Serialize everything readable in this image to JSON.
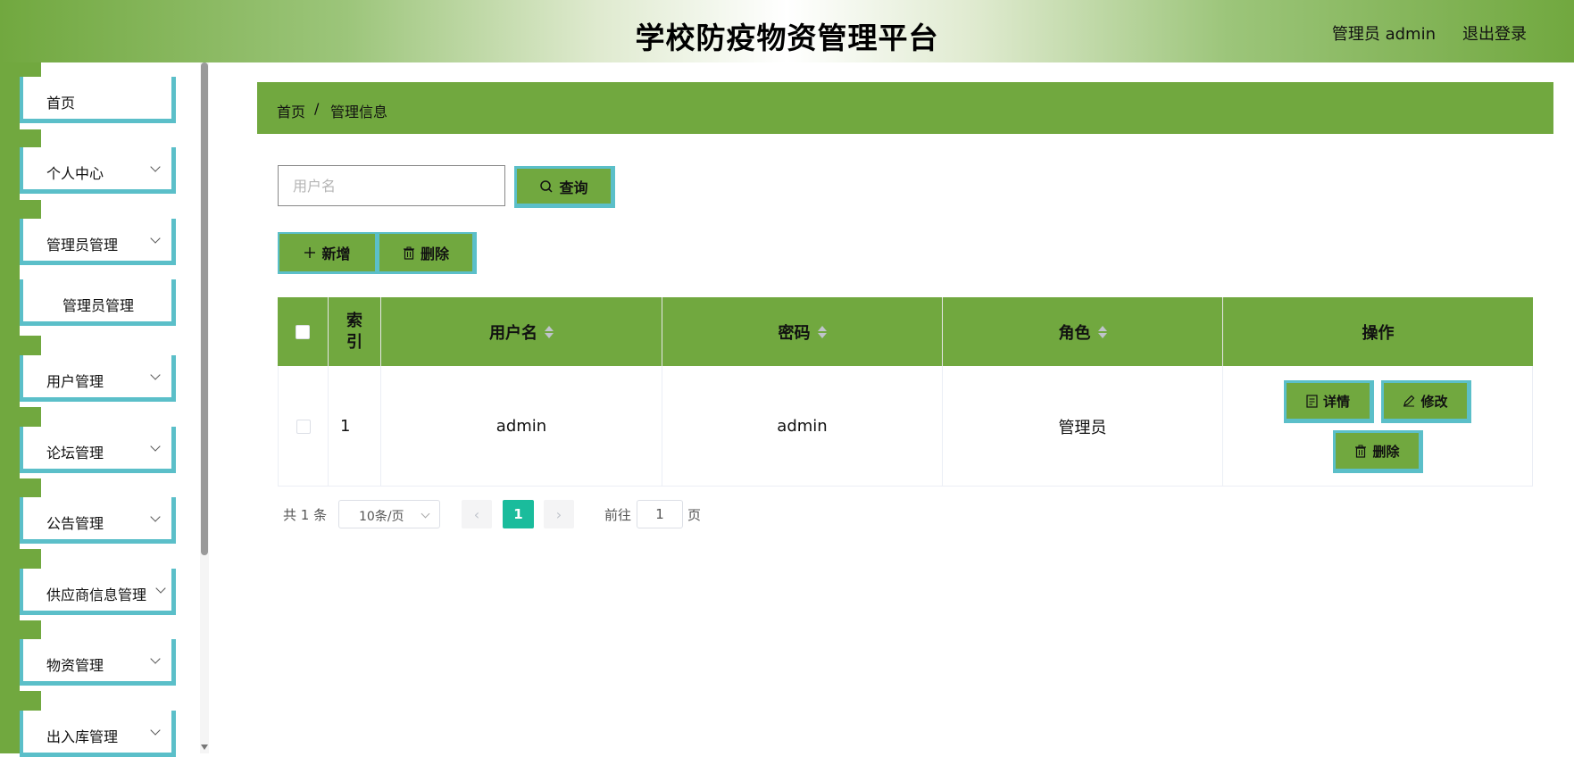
{
  "header": {
    "title": "学校防疫物资管理平台",
    "user": "管理员 admin",
    "logout": "退出登录"
  },
  "sidebar": {
    "items": [
      {
        "label": "首页"
      },
      {
        "label": "个人中心"
      },
      {
        "label": "管理员管理"
      },
      {
        "label": "管理员管理"
      },
      {
        "label": "用户管理"
      },
      {
        "label": "论坛管理"
      },
      {
        "label": "公告管理"
      },
      {
        "label": "供应商信息管理"
      },
      {
        "label": "物资管理"
      },
      {
        "label": "出入库管理"
      }
    ]
  },
  "breadcrumb": {
    "home": "首页",
    "separator": "/",
    "current": "管理信息"
  },
  "search": {
    "placeholder": "用户名",
    "button": "查询"
  },
  "actions": {
    "add": "新增",
    "delete": "删除"
  },
  "table": {
    "columns": [
      "索引",
      "用户名",
      "密码",
      "角色",
      "操作"
    ],
    "rows": [
      {
        "index": "1",
        "username": "admin",
        "password": "admin",
        "role": "管理员",
        "ops": {
          "detail": "详情",
          "edit": "修改",
          "delete": "删除"
        }
      }
    ]
  },
  "pagination": {
    "total": "共 1 条",
    "page_size": "10条/页",
    "current_page": "1",
    "goto_label": "前往",
    "goto_value": "1",
    "goto_unit": "页"
  },
  "colors": {
    "accent_green": "#71a83f",
    "accent_cyan": "#5bbfc9",
    "page_active": "#1abc9c"
  }
}
